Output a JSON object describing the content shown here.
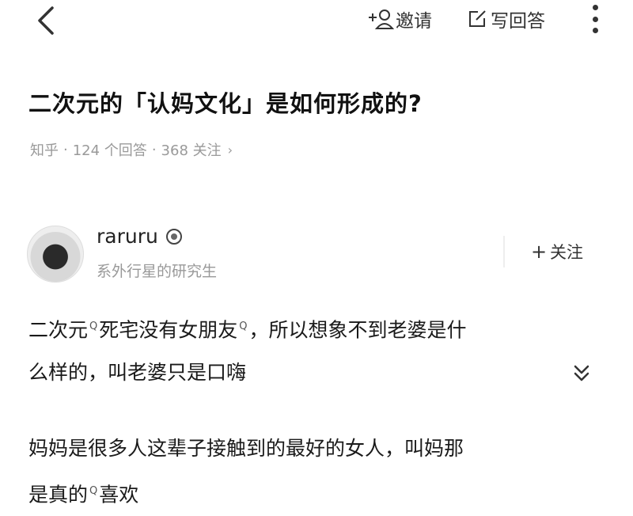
{
  "topbar": {
    "invite_label": "邀请",
    "write_label": "写回答"
  },
  "question": {
    "title": "二次元的「认妈文化」是如何形成的?",
    "source": "知乎",
    "answers": "124 个回答",
    "followers": "368 关注",
    "separator": "·",
    "chevron": "›"
  },
  "author": {
    "name": "raruru",
    "bio": "系外行星的研究生",
    "follow_plus": "+",
    "follow_label": "关注"
  },
  "answer": {
    "para1_line1_a": "二次元",
    "para1_line1_b": "死宅没有女朋友",
    "para1_line1_c": "，所以想象不到老婆是什",
    "para1_line2": "么样的，叫老婆只是口嗨",
    "para2_line1": "妈妈是很多人这辈子接触到的最好的女人，叫妈那",
    "para2_line2_a": "是真的",
    "para2_line2_b": "喜欢",
    "link_glyph": "Q"
  },
  "icons": {
    "back": "back-arrow-icon",
    "invite": "add-person-icon",
    "write": "edit-icon",
    "more": "more-vertical-icon",
    "badge": "verified-badge-icon",
    "expand": "double-chevron-down-icon"
  }
}
